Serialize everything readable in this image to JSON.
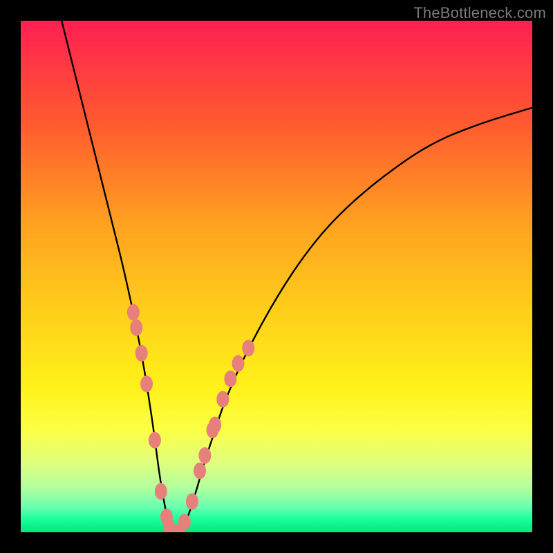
{
  "watermark": "TheBottleneck.com",
  "chart_data": {
    "type": "line",
    "title": "",
    "xlabel": "",
    "ylabel": "",
    "xlim": [
      0,
      100
    ],
    "ylim": [
      0,
      100
    ],
    "grid": false,
    "legend": false,
    "annotations": [],
    "gradient_stops": [
      {
        "offset": 0.0,
        "color": "#ff1f52"
      },
      {
        "offset": 0.2,
        "color": "#ff5a2f"
      },
      {
        "offset": 0.4,
        "color": "#ffa220"
      },
      {
        "offset": 0.58,
        "color": "#ffd21a"
      },
      {
        "offset": 0.72,
        "color": "#fff21a"
      },
      {
        "offset": 0.8,
        "color": "#fbff45"
      },
      {
        "offset": 0.86,
        "color": "#e2ff7a"
      },
      {
        "offset": 0.91,
        "color": "#b7ff9d"
      },
      {
        "offset": 0.95,
        "color": "#6cffb0"
      },
      {
        "offset": 0.975,
        "color": "#1aff9a"
      },
      {
        "offset": 1.0,
        "color": "#00e77a"
      }
    ],
    "series": [
      {
        "name": "bottleneck-curve",
        "x": [
          8,
          10,
          12,
          14,
          16,
          18,
          20,
          22,
          24,
          26,
          27,
          28,
          29,
          30,
          32,
          34,
          36,
          38,
          40,
          44,
          50,
          56,
          62,
          70,
          80,
          90,
          100
        ],
        "y": [
          100,
          92,
          84,
          76,
          68,
          60,
          52,
          43,
          33,
          20,
          12,
          6,
          1,
          0,
          1,
          7,
          14,
          20,
          26,
          35,
          46,
          55,
          62,
          69,
          76,
          80,
          83
        ]
      }
    ],
    "markers": {
      "name": "highlighted-points",
      "color": "#e77f7b",
      "points": [
        {
          "x": 22.0,
          "y": 43
        },
        {
          "x": 22.6,
          "y": 40
        },
        {
          "x": 23.6,
          "y": 35
        },
        {
          "x": 24.6,
          "y": 29
        },
        {
          "x": 26.2,
          "y": 18
        },
        {
          "x": 27.4,
          "y": 8
        },
        {
          "x": 28.5,
          "y": 3
        },
        {
          "x": 29.0,
          "y": 1
        },
        {
          "x": 30.0,
          "y": 0
        },
        {
          "x": 31.0,
          "y": 0
        },
        {
          "x": 32.0,
          "y": 2
        },
        {
          "x": 33.5,
          "y": 6
        },
        {
          "x": 35.0,
          "y": 12
        },
        {
          "x": 36.0,
          "y": 15
        },
        {
          "x": 37.5,
          "y": 20
        },
        {
          "x": 38.0,
          "y": 21
        },
        {
          "x": 39.5,
          "y": 26
        },
        {
          "x": 41.0,
          "y": 30
        },
        {
          "x": 42.5,
          "y": 33
        },
        {
          "x": 44.5,
          "y": 36
        }
      ]
    }
  }
}
